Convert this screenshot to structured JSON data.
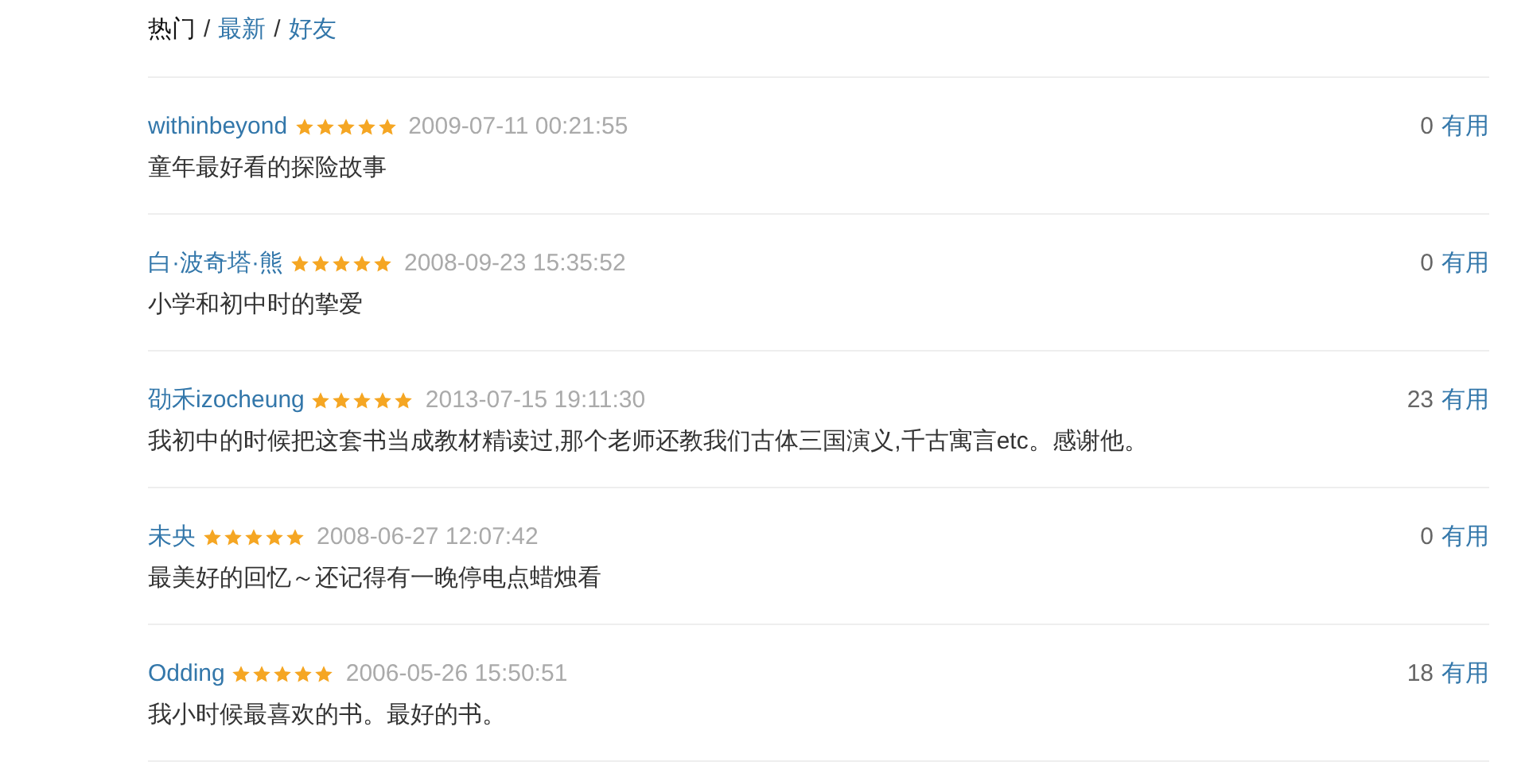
{
  "tabs": [
    {
      "label": "热门",
      "selected": true
    },
    {
      "label": "最新",
      "selected": false
    },
    {
      "label": "好友",
      "selected": false
    }
  ],
  "tab_separator": "/",
  "comments": [
    {
      "user": "withinbeyond",
      "stars": 5,
      "time": "2009-07-11 00:21:55",
      "votes": "0",
      "vote_label": "有用",
      "text": "童年最好看的探险故事"
    },
    {
      "user": "白·波奇塔·熊",
      "stars": 5,
      "time": "2008-09-23 15:35:52",
      "votes": "0",
      "vote_label": "有用",
      "text": "小学和初中时的挚爱"
    },
    {
      "user": "劭禾izocheung",
      "stars": 5,
      "time": "2013-07-15 19:11:30",
      "votes": "23",
      "vote_label": "有用",
      "text": "我初中的时候把这套书当成教材精读过,那个老师还教我们古体三国演义,千古寓言etc。感谢他。"
    },
    {
      "user": "未央",
      "stars": 5,
      "time": "2008-06-27 12:07:42",
      "votes": "0",
      "vote_label": "有用",
      "text": "最美好的回忆～还记得有一晚停电点蜡烛看"
    },
    {
      "user": "Odding",
      "stars": 5,
      "time": "2006-05-26 15:50:51",
      "votes": "18",
      "vote_label": "有用",
      "text": "我小时候最喜欢的书。最好的书。"
    }
  ]
}
